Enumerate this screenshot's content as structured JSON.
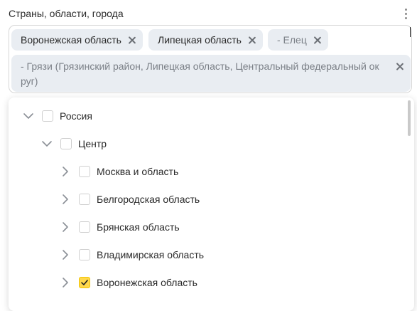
{
  "field_label": "Страны, области, города",
  "chips": [
    {
      "label": "Воронежская область"
    },
    {
      "label": "Липецкая область"
    },
    {
      "label": "- Елец"
    }
  ],
  "long_chip": {
    "line1": "- Грязи (Грязинский район, Липецкая область, Центральный федеральный ок",
    "line2": "руг)"
  },
  "tree": [
    {
      "label": "Россия",
      "expanded": true,
      "checked": false
    },
    {
      "label": "Центр",
      "expanded": true,
      "checked": false
    },
    {
      "label": "Москва и область",
      "expanded": false,
      "checked": false
    },
    {
      "label": "Белгородская область",
      "expanded": false,
      "checked": false
    },
    {
      "label": "Брянская область",
      "expanded": false,
      "checked": false
    },
    {
      "label": "Владимирская область",
      "expanded": false,
      "checked": false
    },
    {
      "label": "Воронежская область",
      "expanded": false,
      "checked": true
    }
  ],
  "colors": {
    "chip_bg": "#e9edf2",
    "checkbox_checked": "#ffd84d"
  }
}
